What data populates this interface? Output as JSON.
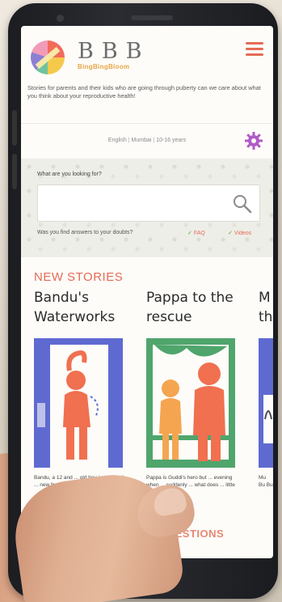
{
  "header": {
    "logo_text": "BBB",
    "logo_subtext": "BingBingBloom",
    "tagline": "Stories for parents and their kids who are going through puberty can we care about what you think about your reproductive health!"
  },
  "preferences": {
    "language": "English",
    "city": "Mumbai",
    "age_group": "10-16 years"
  },
  "search": {
    "label": "What are you looking for?",
    "value": "",
    "help_question": "Was you find answers to your doubts?",
    "option_faq": "FAQ",
    "option_videos": "Videos"
  },
  "stories": {
    "section_title": "NEW STORIES",
    "items": [
      {
        "title": "Bandu's Waterworks",
        "snippet": "Bandu, a 12 and ... old boy is ... lots of ... new feel ..."
      },
      {
        "title": "Pappa to the rescue",
        "snippet": "Pappa is Guddi's hero but ... evening when ... suddenly ... what does ... little princess?"
      },
      {
        "title": "M th",
        "snippet": "Mu Bu Bu"
      }
    ]
  },
  "faq": {
    "section_title": "ASKED QUESTIONS"
  },
  "device": {
    "brand": "LG"
  },
  "colors": {
    "accent": "#e46b55",
    "gear": "#b25ac8",
    "illustration_blue": "#5f6ad1",
    "illustration_green": "#4fa56c",
    "illustration_orange": "#f07050",
    "check": "#7bbf5e"
  }
}
